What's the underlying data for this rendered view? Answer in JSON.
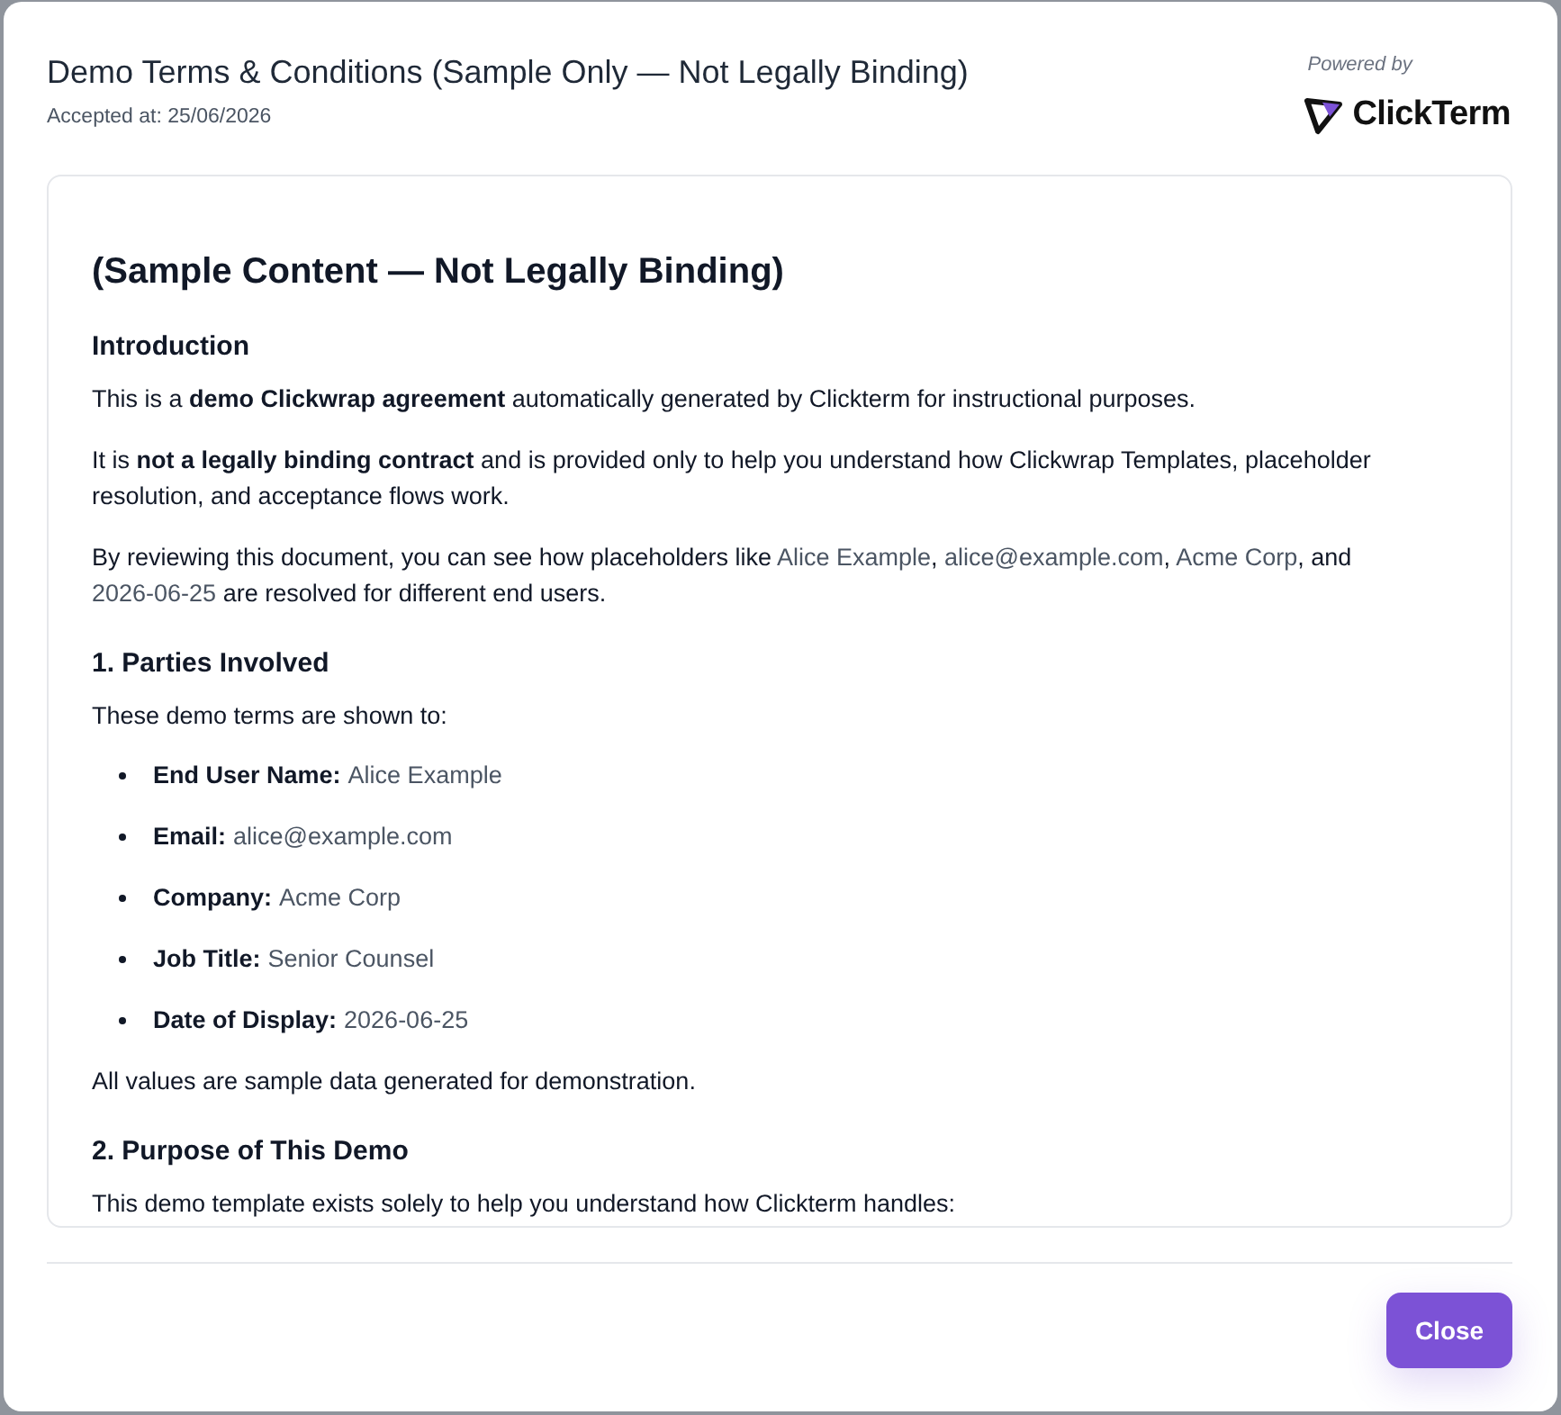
{
  "dialog": {
    "title": "Demo Terms & Conditions (Sample Only — Not Legally Binding)",
    "accepted_at": "Accepted at: 25/06/2026",
    "powered_by": "Powered by",
    "brand": "ClickTerm"
  },
  "document": {
    "blocks": [
      {
        "kind": "title",
        "text": "(Sample Content — Not Legally Binding)"
      },
      {
        "kind": "heading",
        "text": "Introduction"
      },
      {
        "kind": "paragraph",
        "parts": [
          {
            "kind": "text",
            "text": "This is a **demo Clickwrap agreement** automatically generated by Clickterm for instructional purposes."
          }
        ]
      },
      {
        "kind": "paragraph",
        "parts": [
          {
            "kind": "text",
            "text": "It is **not a legally binding contract** and is provided only to help you understand how Clickwrap Templates, placeholder resolution, and acceptance flows work."
          }
        ]
      },
      {
        "kind": "paragraph",
        "parts": [
          {
            "kind": "text",
            "text": "By reviewing this document, you can see how placeholders like "
          },
          {
            "kind": "placeholder",
            "text": "Alice Example"
          },
          {
            "kind": "text",
            "text": ", "
          },
          {
            "kind": "placeholder",
            "text": "alice@example.com"
          },
          {
            "kind": "text",
            "text": ", "
          },
          {
            "kind": "placeholder",
            "text": "Acme Corp"
          },
          {
            "kind": "text",
            "text": ", and "
          },
          {
            "kind": "placeholder",
            "text": "2026-06-25"
          },
          {
            "kind": "text",
            "text": " are resolved for different end users."
          }
        ]
      },
      {
        "kind": "heading",
        "text": "1. Parties Involved"
      },
      {
        "kind": "paragraph",
        "parts": [
          {
            "kind": "text",
            "text": "These demo terms are shown to:"
          }
        ]
      },
      {
        "kind": "list",
        "items": [
          {
            "label": "End User Name:",
            "value": "Alice Example"
          },
          {
            "label": "Email:",
            "value": "alice@example.com"
          },
          {
            "label": "Company:",
            "value": "Acme Corp"
          },
          {
            "label": "Job Title:",
            "value": "Senior Counsel"
          },
          {
            "label": "Date of Display:",
            "value": "2026-06-25"
          }
        ]
      },
      {
        "kind": "paragraph",
        "parts": [
          {
            "kind": "text",
            "text": "All values are sample data generated for demonstration."
          }
        ]
      },
      {
        "kind": "heading",
        "text": "2. Purpose of This Demo"
      },
      {
        "kind": "paragraph",
        "parts": [
          {
            "kind": "text",
            "text": "This demo template exists solely to help you understand how Clickterm handles:"
          }
        ]
      }
    ]
  },
  "footer": {
    "buttons": [
      {
        "label": "Close"
      }
    ]
  }
}
